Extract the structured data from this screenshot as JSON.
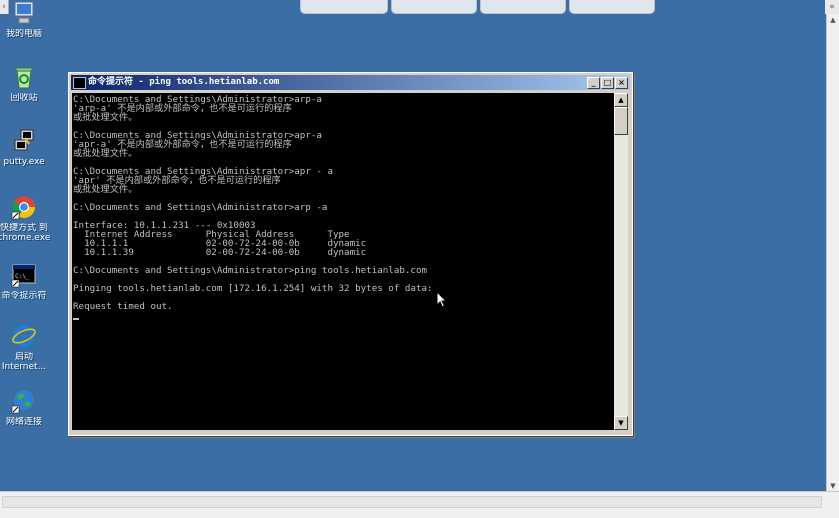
{
  "top_tabs": [
    "",
    "",
    "",
    ""
  ],
  "edge": {
    "left_arrow": "‹",
    "right_arrow": "«"
  },
  "desktop_icons": [
    {
      "name": "my-computer",
      "label": "我的电脑"
    },
    {
      "name": "recycle-bin",
      "label": "回收站"
    },
    {
      "name": "putty",
      "label": "putty.exe"
    },
    {
      "name": "chrome-shortcut",
      "label": "快捷方式 到",
      "label2": "chrome.exe"
    },
    {
      "name": "cmd-shortcut",
      "label": "命令提示符"
    },
    {
      "name": "ie",
      "label": "启动",
      "label2": "Internet..."
    },
    {
      "name": "network",
      "label": "网络连接"
    }
  ],
  "window": {
    "title": "命令提示符 - ping tools.hetianlab.com",
    "buttons": {
      "minimize": "_",
      "maximize": "□",
      "close": "×"
    }
  },
  "console_lines": [
    "C:\\Documents and Settings\\Administrator>arp-a",
    "'arp-a' 不是内部或外部命令，也不是可运行的程序",
    "或批处理文件。",
    "",
    "C:\\Documents and Settings\\Administrator>apr-a",
    "'apr-a' 不是内部或外部命令，也不是可运行的程序",
    "或批处理文件。",
    "",
    "C:\\Documents and Settings\\Administrator>apr - a",
    "'apr' 不是内部或外部命令，也不是可运行的程序",
    "或批处理文件。",
    "",
    "C:\\Documents and Settings\\Administrator>arp -a",
    "",
    "Interface: 10.1.1.231 --- 0x10003",
    "  Internet Address      Physical Address      Type",
    "  10.1.1.1              02-00-72-24-00-0b     dynamic",
    "  10.1.1.39             02-00-72-24-00-0b     dynamic",
    "",
    "C:\\Documents and Settings\\Administrator>ping tools.hetianlab.com",
    "",
    "Pinging tools.hetianlab.com [172.16.1.254] with 32 bytes of data:",
    "",
    "Request timed out.",
    ""
  ],
  "colors": {
    "desktop": "#3a6ea5",
    "console_bg": "#000000",
    "console_fg": "#c0c0c0",
    "title_start": "#0a246a",
    "title_end": "#a6caf0"
  }
}
